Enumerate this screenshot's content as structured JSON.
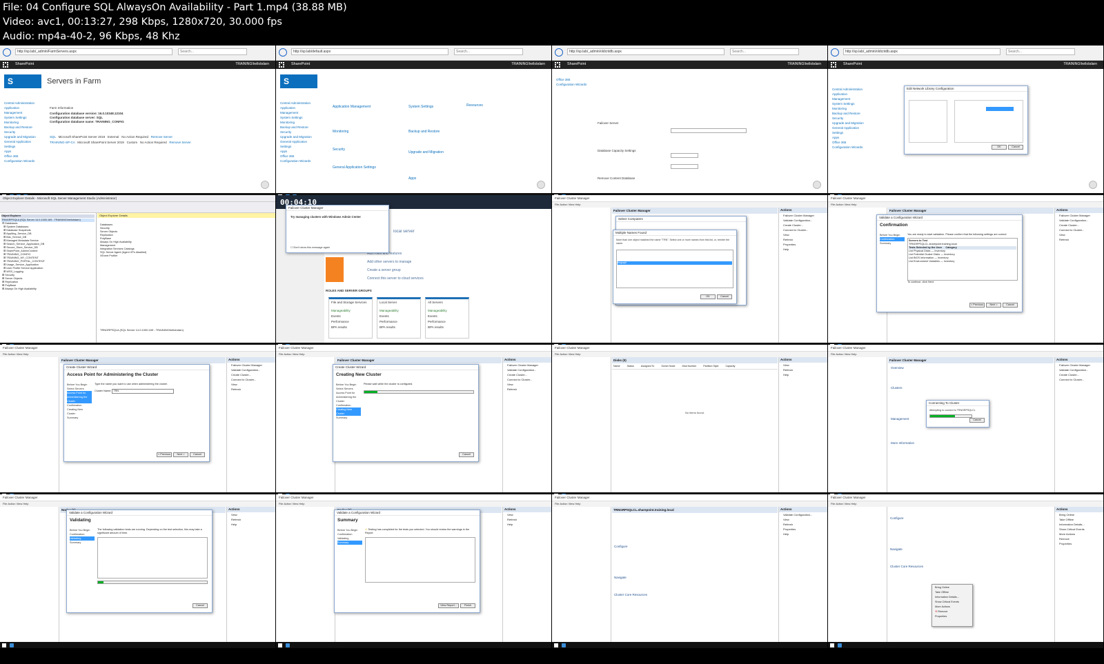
{
  "header": {
    "file": "File: 04  Configure SQL AlwaysOn Availability - Part 1.mp4 (38.88 MB)",
    "video": "Video: avc1, 00:13:27, 298 Kbps, 1280x720, 30.000 fps",
    "audio": "Audio: mp4a-40-2, 96 Kbps, 48 Khz"
  },
  "sharepoint": {
    "app": "SharePoint",
    "user": "TRAINING\\hellobdarn",
    "servers_title": "Servers in Farm",
    "leftnav": [
      "Central Administration",
      "Application Management",
      "System Settings",
      "Monitoring",
      "Backup and Restore",
      "Security",
      "Upgrade and Migration",
      "General Application Settings",
      "Apps",
      "Office 365",
      "Configuration Wizards"
    ],
    "farm_info_label": "Farm Information",
    "config_db_version": "Configuration database version: 16.0.10348.12104",
    "config_db_server": "Configuration database server: SQL",
    "config_db_name": "Configuration database name: TRAINING_CONFIG",
    "servers": [
      {
        "server": "SQL",
        "product": "Microsoft SharePoint Server 2019",
        "role": "External",
        "status": "No Action Required",
        "remove": "Remove Server"
      },
      {
        "server": "TRAINING-SP-CA",
        "product": "Microsoft SharePoint Server 2019",
        "role": "Custom",
        "status": "No Action Required",
        "remove": "Remove Server"
      }
    ],
    "sections": [
      "Application Management",
      "System Settings",
      "Resources",
      "Monitoring",
      "Backup and Restore",
      "Security",
      "Upgrade and Migration",
      "General Application Settings",
      "Apps"
    ]
  },
  "ssms": {
    "title": "Object Explorer Details - Microsoft SQL Server Management Studio (Administrator)",
    "oe_caption": "Object Explorer",
    "server_node": "TRNGRPSQLA (SQL Server 14.0.1000.169 - TRAINING\\hellobdarn)",
    "tree": [
      "Databases",
      "System Databases",
      "Database Snapshots",
      "AppMng_Service_DB",
      "Bdc_Service_DB",
      "Managed Metadata Service",
      "Search_Service_Application_DB",
      "Secure_Store_Service_DB",
      "SharePoint_AdminContent",
      "TRAINING_CONFIG",
      "TRAINING_MY_CONTENT",
      "TRAINING_PORTAL_CONTENT",
      "Usage_Service_Application",
      "User Profile Service Application",
      "WSS_Logging",
      "Security",
      "Server Objects",
      "Replication",
      "PolyBase",
      "Always On High Availability"
    ],
    "details_tab": "Object Explorer Details",
    "details_items": [
      "Databases",
      "Security",
      "Server Objects",
      "Replication",
      "PolyBase",
      "Always On High Availability",
      "Management",
      "Integration Services Catalogs",
      "SQL Server Agent (Agent XPs disabled)",
      "XEvent Profiler"
    ],
    "status": "Ready"
  },
  "server_manager": {
    "timecode": "00:04:10",
    "dialog_title": "Failover Cluster Manager",
    "dialog_heading": "Try managing clusters with Windows Admin Center",
    "dialog_checkbox": "Don't show this message again",
    "welcome": "local server",
    "quick_links": [
      "Add roles and features",
      "Add other servers to manage",
      "Create a server group",
      "Connect this server to cloud services"
    ],
    "groups_heading": "ROLES AND SERVER GROUPS",
    "tiles": [
      "File and Storage Services",
      "Local Server",
      "All Servers"
    ],
    "tile_rows": [
      "Manageability",
      "Events",
      "Performance",
      "BPA results"
    ]
  },
  "fcm": {
    "app": "Failover Cluster Manager",
    "menu": "File  Action  View  Help",
    "actions_header": "Actions",
    "actions": [
      "Failover Cluster Manager",
      "Validate Configuration...",
      "Create Cluster...",
      "Connect to Cluster...",
      "View",
      "Refresh",
      "Properties",
      "Help"
    ],
    "status_text": "This action launches a wizard that will guide you through the process of creating a new cluster.",
    "select_computers_title": "Select Computers",
    "multiple_names_title": "Multiple Names Found",
    "multiple_names_msg": "More than one object matched the name \"TRN\". Select one or more names from this list, or, reenter the name.",
    "matching_names": [
      "trngsqla",
      "trngsqlb",
      "trngsqlc",
      "trngsqld",
      "trngsqle",
      "trngsqlf"
    ],
    "ok": "OK",
    "cancel": "Cancel",
    "confirmation_title": "Validate a Configuration Wizard",
    "confirmation_heading": "Confirmation",
    "confirmation_text": "You are ready to start validation. Please confirm that the following settings are correct:",
    "servers_to_test": "Servers to Test",
    "tests_selected": "Tests Selected by the User",
    "category": "Category",
    "tests": [
      "List Physical Disks",
      "List Potential Cluster Disks",
      "List BIOS Information",
      "List Environment Variables"
    ],
    "inventory": "Inventory",
    "continue_text": "To continue, click Next.",
    "previous": "< Previous",
    "next": "Next >",
    "access_point_title": "Create Cluster Wizard",
    "access_point_heading": "Access Point for Administering the Cluster",
    "access_point_text": "Type the name you want to use when administering the cluster.",
    "cluster_name_label": "Cluster Name:",
    "cluster_name_value": "TRN",
    "wizard_steps": [
      "Before You Begin",
      "Select Servers",
      "Access Point for Administering the Cluster",
      "Confirmation",
      "Creating New Cluster",
      "Summary"
    ],
    "creating_heading": "Creating New Cluster",
    "creating_text": "Please wait while the cluster is configured.",
    "creating_progress": 0.12,
    "disks_header": "Disks (0)",
    "disks_columns": [
      "Name",
      "Status",
      "Assigned To",
      "Owner Node",
      "Disk Number",
      "Partition Style",
      "Capacity"
    ],
    "disks_empty": "No items found.",
    "connecting_title": "Connecting To Cluster",
    "connecting_text": "Attempting to connect to TRNGRPSQLCL",
    "connecting_progress": 0.6,
    "overview": "Overview",
    "clusters": "Clusters",
    "management": "Management",
    "more_info": "More Information",
    "validating_heading": "Validating",
    "validating_text": "The following validation tests are running. Depending on the test selection, this may take a significant amount of time.",
    "validating_progress": 0.05,
    "summary_heading": "Summary",
    "summary_text": "Testing has completed for the tests you selected. You should review the warnings in the Report.",
    "view_report": "View Report...",
    "finish": "Finish",
    "nodes_header": "Nodes (1)",
    "cluster_summary": "Summary of Cluster TRNGRPSQLCL",
    "cluster_fqdn": "TRNGRPSQLCL.sharepoint.training.local",
    "cluster_host_info": "TRNGRPSQLCL has 0 clustered roles and 2 nodes.",
    "configure": "Configure",
    "navigate": "Navigate",
    "cluster_core_resources": "Cluster Core Resources",
    "context_menu": [
      "Bring Online",
      "Take Offline",
      "Information Details...",
      "Show Critical Events",
      "More Actions",
      "Remove",
      "Properties"
    ]
  }
}
